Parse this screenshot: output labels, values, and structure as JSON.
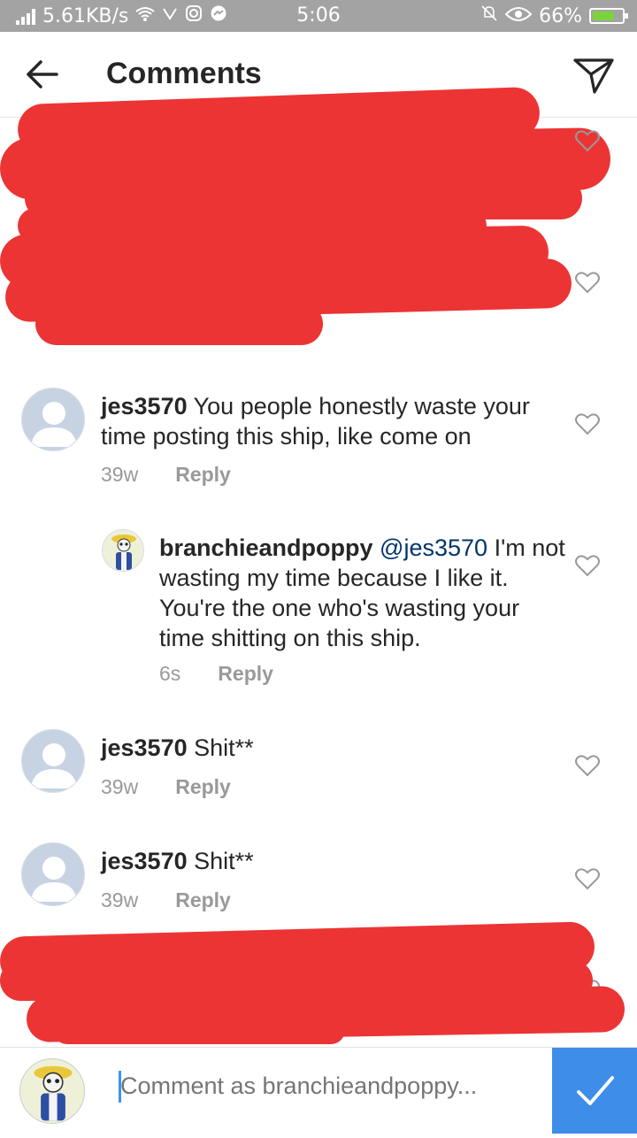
{
  "status_bar": {
    "speed": "5.61KB/s",
    "time": "5:06",
    "battery": "66%"
  },
  "header": {
    "title": "Comments"
  },
  "comments": [
    {
      "username": "jes3570",
      "text": "You people honestly waste your time posting this ship, like come on",
      "age": "39w",
      "reply_label": "Reply"
    },
    {
      "username": "branchieandpoppy",
      "mention": "@jes3570",
      "text": "I'm not wasting my time because I like it. You're the one who's wasting your time shitting on this ship.",
      "age": "6s",
      "reply_label": "Reply"
    },
    {
      "username": "jes3570",
      "text": "Shit**",
      "age": "39w",
      "reply_label": "Reply"
    },
    {
      "username": "jes3570",
      "text": "Shit**",
      "age": "39w",
      "reply_label": "Reply"
    }
  ],
  "composer": {
    "placeholder": "Comment as branchieandpoppy..."
  },
  "colors": {
    "accent": "#3e8de8",
    "redaction": "#ec3434",
    "mention": "#003569"
  }
}
